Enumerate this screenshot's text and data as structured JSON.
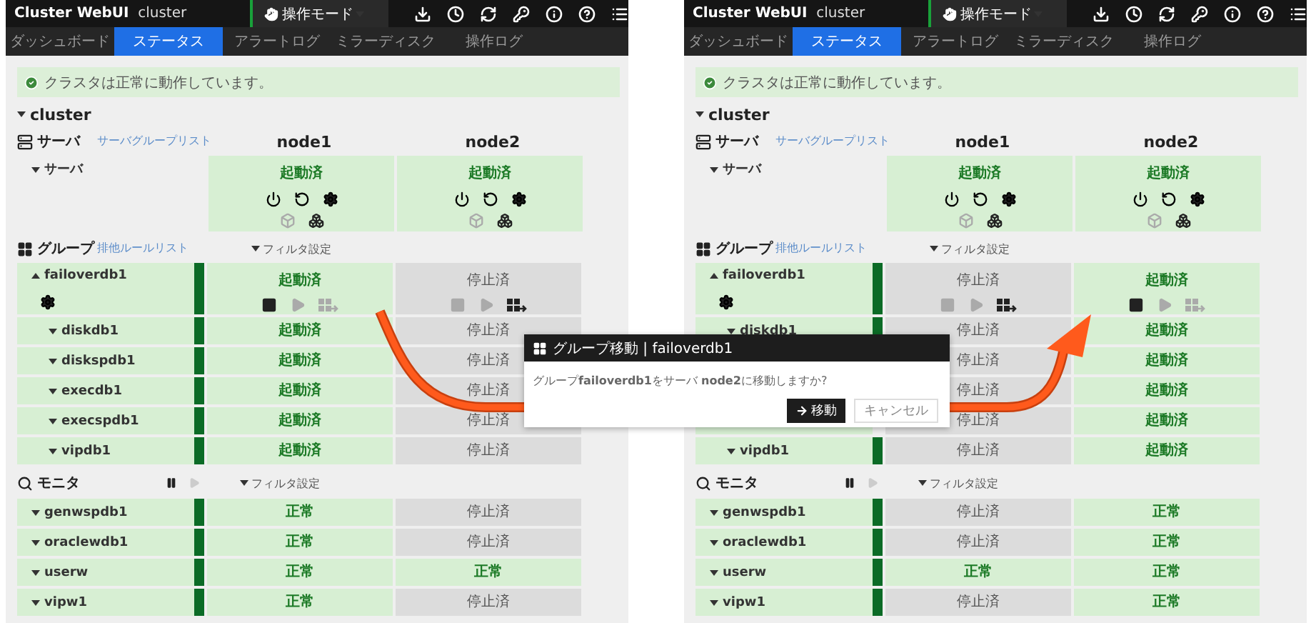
{
  "panels": [
    {
      "header": {
        "brand": "Cluster WebUI",
        "cluster": "cluster",
        "mode": "操作モード"
      },
      "tabs": [
        {
          "label": "ダッシュボード",
          "selected": false
        },
        {
          "label": "ステータス",
          "selected": true
        },
        {
          "label": "アラートログ",
          "selected": false
        },
        {
          "label": "ミラーディスク",
          "selected": false
        },
        {
          "label": "操作ログ",
          "selected": false
        }
      ],
      "alert": "クラスタは正常に動作しています。",
      "cluster_title": "cluster",
      "servers": {
        "label": "サーバ",
        "link": "サーバグループリスト",
        "nodes": [
          "node1",
          "node2"
        ],
        "row": {
          "label": "サーバ",
          "cells": [
            {
              "status": "起動済",
              "online": true
            },
            {
              "status": "起動済",
              "online": true
            }
          ]
        }
      },
      "groups": {
        "label": "グループ",
        "link": "排他ルールリスト",
        "filter": "フィルタ設定",
        "group": {
          "name": "failoverdb1",
          "expanded": true,
          "cells": [
            {
              "status": "起動済",
              "online": true
            },
            {
              "status": "停止済",
              "online": false
            }
          ]
        },
        "resources": [
          {
            "name": "diskdb1",
            "expanded": false,
            "cells": [
              {
                "status": "起動済",
                "online": true
              },
              {
                "status": "停止済",
                "online": false
              }
            ]
          },
          {
            "name": "diskspdb1",
            "expanded": false,
            "cells": [
              {
                "status": "起動済",
                "online": true
              },
              {
                "status": "停止済",
                "online": false
              }
            ]
          },
          {
            "name": "execdb1",
            "expanded": false,
            "cells": [
              {
                "status": "起動済",
                "online": true
              },
              {
                "status": "停止済",
                "online": false
              }
            ]
          },
          {
            "name": "execspdb1",
            "expanded": false,
            "cells": [
              {
                "status": "起動済",
                "online": true
              },
              {
                "status": "停止済",
                "online": false
              }
            ]
          },
          {
            "name": "vipdb1",
            "expanded": false,
            "cells": [
              {
                "status": "起動済",
                "online": true
              },
              {
                "status": "停止済",
                "online": false
              }
            ]
          }
        ]
      },
      "monitors": {
        "label": "モニタ",
        "filter": "フィルタ設定",
        "rows": [
          {
            "name": "genwspdb1",
            "cells": [
              {
                "status": "正常",
                "online": true
              },
              {
                "status": "停止済",
                "online": false
              }
            ]
          },
          {
            "name": "oraclewdb1",
            "cells": [
              {
                "status": "正常",
                "online": true
              },
              {
                "status": "停止済",
                "online": false
              }
            ]
          },
          {
            "name": "userw",
            "cells": [
              {
                "status": "正常",
                "online": true
              },
              {
                "status": "正常",
                "online": true
              }
            ]
          },
          {
            "name": "vipw1",
            "cells": [
              {
                "status": "正常",
                "online": true
              },
              {
                "status": "停止済",
                "online": false
              }
            ]
          }
        ]
      }
    },
    {
      "header": {
        "brand": "Cluster WebUI",
        "cluster": "cluster",
        "mode": "操作モード"
      },
      "tabs": [
        {
          "label": "ダッシュボード",
          "selected": false
        },
        {
          "label": "ステータス",
          "selected": true
        },
        {
          "label": "アラートログ",
          "selected": false
        },
        {
          "label": "ミラーディスク",
          "selected": false
        },
        {
          "label": "操作ログ",
          "selected": false
        }
      ],
      "alert": "クラスタは正常に動作しています。",
      "cluster_title": "cluster",
      "servers": {
        "label": "サーバ",
        "link": "サーバグループリスト",
        "nodes": [
          "node1",
          "node2"
        ],
        "row": {
          "label": "サーバ",
          "cells": [
            {
              "status": "起動済",
              "online": true
            },
            {
              "status": "起動済",
              "online": true
            }
          ]
        }
      },
      "groups": {
        "label": "グループ",
        "link": "排他ルールリスト",
        "filter": "フィルタ設定",
        "group": {
          "name": "failoverdb1",
          "expanded": true,
          "cells": [
            {
              "status": "停止済",
              "online": false
            },
            {
              "status": "起動済",
              "online": true
            }
          ]
        },
        "resources": [
          {
            "name": "diskdb1",
            "expanded": false,
            "cells": [
              {
                "status": "停止済",
                "online": false
              },
              {
                "status": "起動済",
                "online": true
              }
            ]
          },
          {
            "cells": [
              {
                "status": "停止済",
                "online": false
              },
              {
                "status": "起動済",
                "online": true
              }
            ]
          },
          {
            "cells": [
              {
                "status": "停止済",
                "online": false
              },
              {
                "status": "起動済",
                "online": true
              }
            ]
          },
          {
            "cells": [
              {
                "status": "停止済",
                "online": false
              },
              {
                "status": "起動済",
                "online": true
              }
            ]
          },
          {
            "name": "vipdb1",
            "expanded": false,
            "cells": [
              {
                "status": "停止済",
                "online": false
              },
              {
                "status": "起動済",
                "online": true
              }
            ]
          }
        ]
      },
      "monitors": {
        "label": "モニタ",
        "filter": "フィルタ設定",
        "rows": [
          {
            "name": "genwspdb1",
            "cells": [
              {
                "status": "停止済",
                "online": false
              },
              {
                "status": "正常",
                "online": true
              }
            ]
          },
          {
            "name": "oraclewdb1",
            "cells": [
              {
                "status": "停止済",
                "online": false
              },
              {
                "status": "正常",
                "online": true
              }
            ]
          },
          {
            "name": "userw",
            "cells": [
              {
                "status": "正常",
                "online": true
              },
              {
                "status": "正常",
                "online": true
              }
            ]
          },
          {
            "name": "vipw1",
            "cells": [
              {
                "status": "停止済",
                "online": false
              },
              {
                "status": "正常",
                "online": true
              }
            ]
          }
        ]
      }
    }
  ],
  "dialog": {
    "title": "グループ移動 | failoverdb1",
    "message": "グループ**failoverdb1**をサーバ **node2**に移動しますか?",
    "confirm": "移動",
    "cancel": "キャンセル"
  }
}
